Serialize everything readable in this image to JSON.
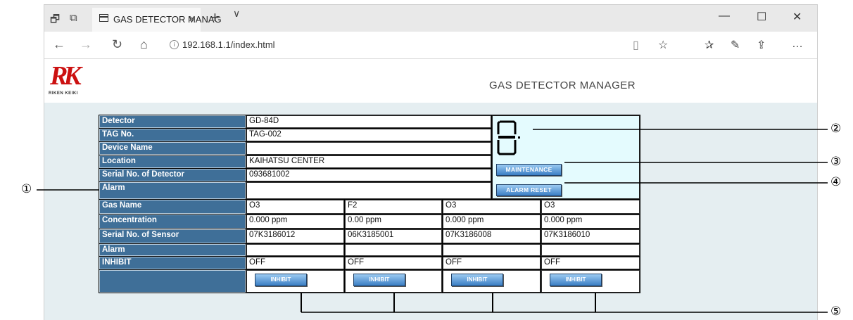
{
  "browser": {
    "tab_title": "GAS DETECTOR MANAG",
    "address": "192.168.1.1/index.html"
  },
  "header": {
    "logo_text": "RIKEN KEIKI",
    "title": "GAS DETECTOR MANAGER"
  },
  "detector_info": [
    {
      "label": "Detector",
      "value": "GD-84D"
    },
    {
      "label": "TAG No.",
      "value": "TAG-002"
    },
    {
      "label": "Device Name",
      "value": ""
    },
    {
      "label": "Location",
      "value": "KAIHATSU CENTER"
    },
    {
      "label": "Serial No. of Detector",
      "value": "093681002"
    },
    {
      "label": "Alarm",
      "value": ""
    }
  ],
  "status_panel": {
    "maintenance_label": "MAINTENANCE",
    "alarm_reset_label": "ALARM RESET"
  },
  "sensor_labels": {
    "gas_name": "Gas Name",
    "concentration": "Concentration",
    "serial": "Serial No. of Sensor",
    "alarm": "Alarm",
    "inhibit": "INHIBIT"
  },
  "sensors": [
    {
      "gas": "O3",
      "concentration": "0.000 ppm",
      "serial": "07K3186012",
      "alarm": "",
      "inhibit": "OFF",
      "button": "INHIBIT"
    },
    {
      "gas": "F2",
      "concentration": "0.00 ppm",
      "serial": "06K3185001",
      "alarm": "",
      "inhibit": "OFF",
      "button": "INHIBIT"
    },
    {
      "gas": "O3",
      "concentration": "0.000 ppm",
      "serial": "07K3186008",
      "alarm": "",
      "inhibit": "OFF",
      "button": "INHIBIT"
    },
    {
      "gas": "O3",
      "concentration": "0.000 ppm",
      "serial": "07K3186010",
      "alarm": "",
      "inhibit": "OFF",
      "button": "INHIBIT"
    }
  ],
  "callouts": [
    "①",
    "②",
    "③",
    "④",
    "⑤"
  ]
}
